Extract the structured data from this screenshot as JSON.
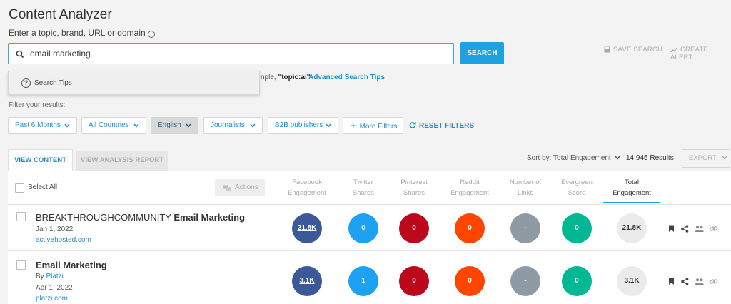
{
  "app": {
    "title": "Content Analyzer",
    "subtitle": "Enter a topic, brand, URL or domain",
    "info_icon": "i"
  },
  "search": {
    "value": "email marketing",
    "button": "SEARCH",
    "save_label": "SAVE SEARCH",
    "alert_label": "CREATE ALERT"
  },
  "tips": {
    "dropdown_label": "Search Tips",
    "question_glyph": "?",
    "hint_prefix": "nple, ",
    "hint_example": "\"topic:ai\"",
    "advanced_link": "Advanced Search Tips"
  },
  "filters": {
    "label": "Filter your results:",
    "items": [
      {
        "label": "Past 6 Months"
      },
      {
        "label": "All Countries"
      },
      {
        "label": "English"
      },
      {
        "label": "Journalists"
      },
      {
        "label": "B2B publishers"
      }
    ],
    "more": "More Filters",
    "more_plus": "+",
    "reset": "RESET FILTERS"
  },
  "tabs": {
    "content": "VIEW CONTENT",
    "report": "VIEW ANALYSIS REPORT"
  },
  "results_bar": {
    "sort": "Sort by: Total Engagement",
    "count": "14,945 Results",
    "export": "EXPORT"
  },
  "table": {
    "select_all": "Select All",
    "actions": "Actions",
    "columns": [
      {
        "line1": "Facebook",
        "line2": "Engagement"
      },
      {
        "line1": "Twitter",
        "line2": "Shares"
      },
      {
        "line1": "Pinterest",
        "line2": "Shares"
      },
      {
        "line1": "Reddit",
        "line2": "Engagement"
      },
      {
        "line1": "Number of",
        "line2": "Links"
      },
      {
        "line1": "Evergreen",
        "line2": "Score"
      },
      {
        "line1": "Total",
        "line2": "Engagement"
      }
    ],
    "rows": [
      {
        "title_prefix": "BREAKTHROUGHCOMMUNITY ",
        "title_bold": "Email Marketing",
        "by_label": "",
        "author": "",
        "date": "Jan 1, 2022",
        "domain": "activehosted.com",
        "facebook": "21.8K",
        "twitter": "0",
        "pinterest": "0",
        "reddit": "0",
        "links": "-",
        "evergreen": "0",
        "total": "21.8K"
      },
      {
        "title_prefix": "",
        "title_bold": "Email Marketing",
        "by_label": "By",
        "author": "Platzi",
        "date": "Apr 1, 2022",
        "domain": "platzi.com",
        "facebook": "3.1K",
        "twitter": "1",
        "pinterest": "0",
        "reddit": "0",
        "links": "-",
        "evergreen": "0",
        "total": "3.1K"
      }
    ]
  },
  "colors": {
    "accent": "#1da1e0",
    "facebook": "#3b5998",
    "twitter": "#1da1f2",
    "pinterest": "#bd081c",
    "reddit": "#ff4500",
    "links": "#8e9ba5",
    "evergreen": "#00b894",
    "total": "#ebebeb"
  },
  "icons": {
    "search": "magnifier-icon",
    "save": "floppy-icon",
    "alert": "trend-icon",
    "bookmark": "bookmark-icon",
    "share": "share-icon",
    "influencers": "people-icon",
    "link": "link-icon"
  }
}
